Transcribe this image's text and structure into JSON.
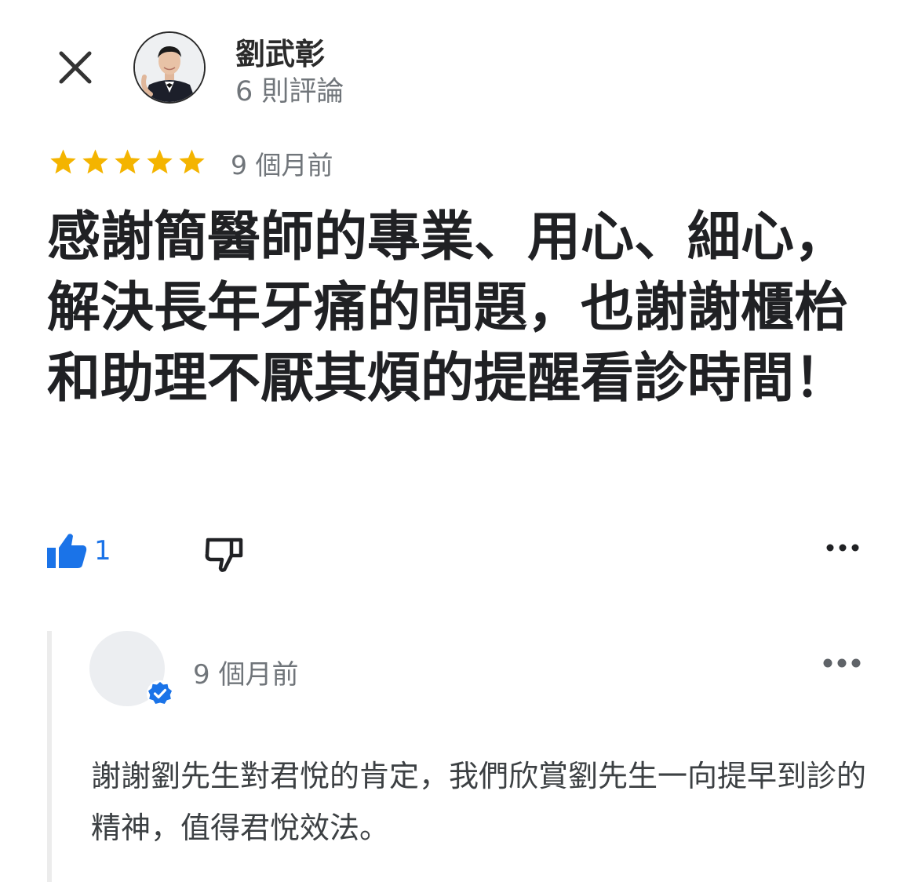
{
  "review": {
    "author": {
      "name": "劉武彰",
      "review_count": "6 則評論",
      "avatar_icon": "profile-photo"
    },
    "rating": 5,
    "max_rating": 5,
    "star_color": "#f4b400",
    "time": "9 個月前",
    "text": "感謝簡醫師的專業、用心、細心，解決長年牙痛的問題，也謝謝櫃枱和助理不厭其煩的提醒看診時間！",
    "likes": "1",
    "like_icon": "thumbs-up-icon",
    "dislike_icon": "thumbs-down-icon",
    "more_icon": "more-options-icon"
  },
  "reply": {
    "time": "9 個月前",
    "text": "謝謝劉先生對君悅的肯定，我們欣賞劉先生一向提早到診的精神，值得君悅效法。",
    "verified_icon": "verified-badge-icon",
    "more_icon": "more-options-icon"
  },
  "colors": {
    "accent": "#1a73e8",
    "text": "#202124",
    "muted": "#70757a"
  }
}
